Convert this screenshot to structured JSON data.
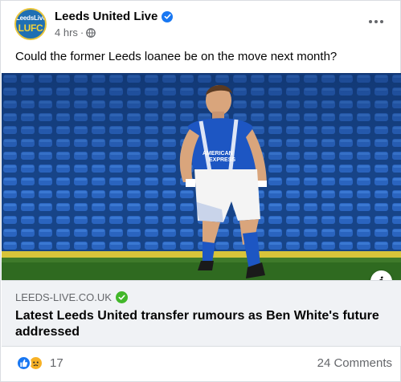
{
  "post": {
    "page_name": "Leeds United Live",
    "avatar_text_top": "LeedsLive",
    "avatar_text_bottom": "LUFC",
    "timestamp": "4 hrs",
    "separator": "·",
    "caption": "Could the former Leeds loanee be on the move next month?"
  },
  "image": {
    "shirt_sponsor_line1": "AMERICAN",
    "shirt_sponsor_line2": "EXPRESS",
    "info_label": "i"
  },
  "link_preview": {
    "domain": "LEEDS-LIVE.CO.UK",
    "title": "Latest Leeds United transfer rumours as Ben White's future addressed"
  },
  "footer": {
    "reaction_count": "17",
    "comments": "24 Comments"
  },
  "icons": {
    "verified": "verified-badge-icon",
    "globe": "globe-icon",
    "more": "more-options-icon",
    "like": "like-reaction-icon",
    "sad": "sad-reaction-icon",
    "domain_check": "domain-verified-icon"
  },
  "colors": {
    "verified_blue": "#1877f2",
    "domain_green": "#42b72a",
    "secondary_text": "#65676b",
    "seat_blue": "#1b4d9c"
  }
}
